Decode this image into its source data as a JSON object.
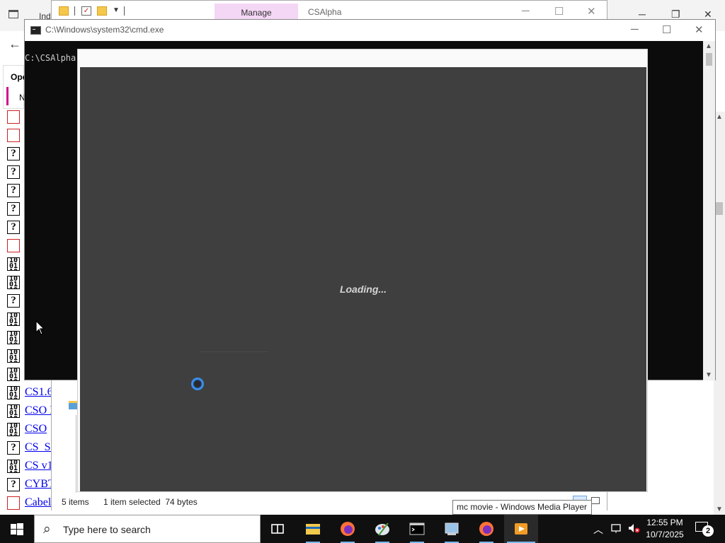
{
  "browser": {
    "tab_fragment": "Ind",
    "panel_label_1": "Ope",
    "panel_label_2": "N",
    "files": [
      {
        "name": "",
        "icon": "red-exe-icon"
      },
      {
        "name": "",
        "icon": "red-exe-icon"
      },
      {
        "name": "",
        "icon": "unknown-file-icon"
      },
      {
        "name": "",
        "icon": "unknown-file-icon"
      },
      {
        "name": "",
        "icon": "unknown-file-icon"
      },
      {
        "name": "",
        "icon": "unknown-file-icon"
      },
      {
        "name": "",
        "icon": "unknown-file-icon"
      },
      {
        "name": "",
        "icon": "red-exe-icon"
      },
      {
        "name": "",
        "icon": "binary-file-icon"
      },
      {
        "name": "",
        "icon": "binary-file-icon"
      },
      {
        "name": "",
        "icon": "unknown-file-icon"
      },
      {
        "name": "",
        "icon": "binary-file-icon"
      },
      {
        "name": "",
        "icon": "binary-file-icon"
      },
      {
        "name": "",
        "icon": "binary-file-icon"
      },
      {
        "name": "",
        "icon": "binary-file-icon"
      },
      {
        "name": "CS1.6",
        "icon": "binary-file-icon"
      },
      {
        "name": "CSO I",
        "icon": "binary-file-icon"
      },
      {
        "name": "CSO",
        "icon": "binary-file-icon"
      },
      {
        "name": "CS_Sc",
        "icon": "unknown-file-icon"
      },
      {
        "name": "CS v1",
        "icon": "binary-file-icon"
      },
      {
        "name": "CYBT",
        "icon": "unknown-file-icon"
      },
      {
        "name": "Cabel",
        "icon": "red-exe-icon"
      }
    ]
  },
  "explorer": {
    "manage_label": "Manage",
    "title": "CSAlpha",
    "status_items": "5 items",
    "status_selected": "1 item selected  74 bytes"
  },
  "cmd": {
    "title": "C:\\Windows\\system32\\cmd.exe",
    "prompt_text": "C:\\CSAlpha"
  },
  "loader": {
    "message": "Loading..."
  },
  "tooltip": {
    "text": "mc movie - Windows Media Player"
  },
  "taskbar": {
    "search_placeholder": "Type here to search",
    "time": "12:55 PM",
    "date": "10/7/2025",
    "notification_count": "2",
    "apps": [
      "task-view",
      "file-explorer",
      "firefox",
      "paint",
      "cmd",
      "control-panel",
      "firefox",
      "windows-media-player"
    ]
  },
  "colors": {
    "accent": "#76b9ed",
    "loader_bg": "#3f3f3f",
    "spinner": "#3d8ee6",
    "manage_tab": "#f4d6f5",
    "link": "#0000ee"
  }
}
